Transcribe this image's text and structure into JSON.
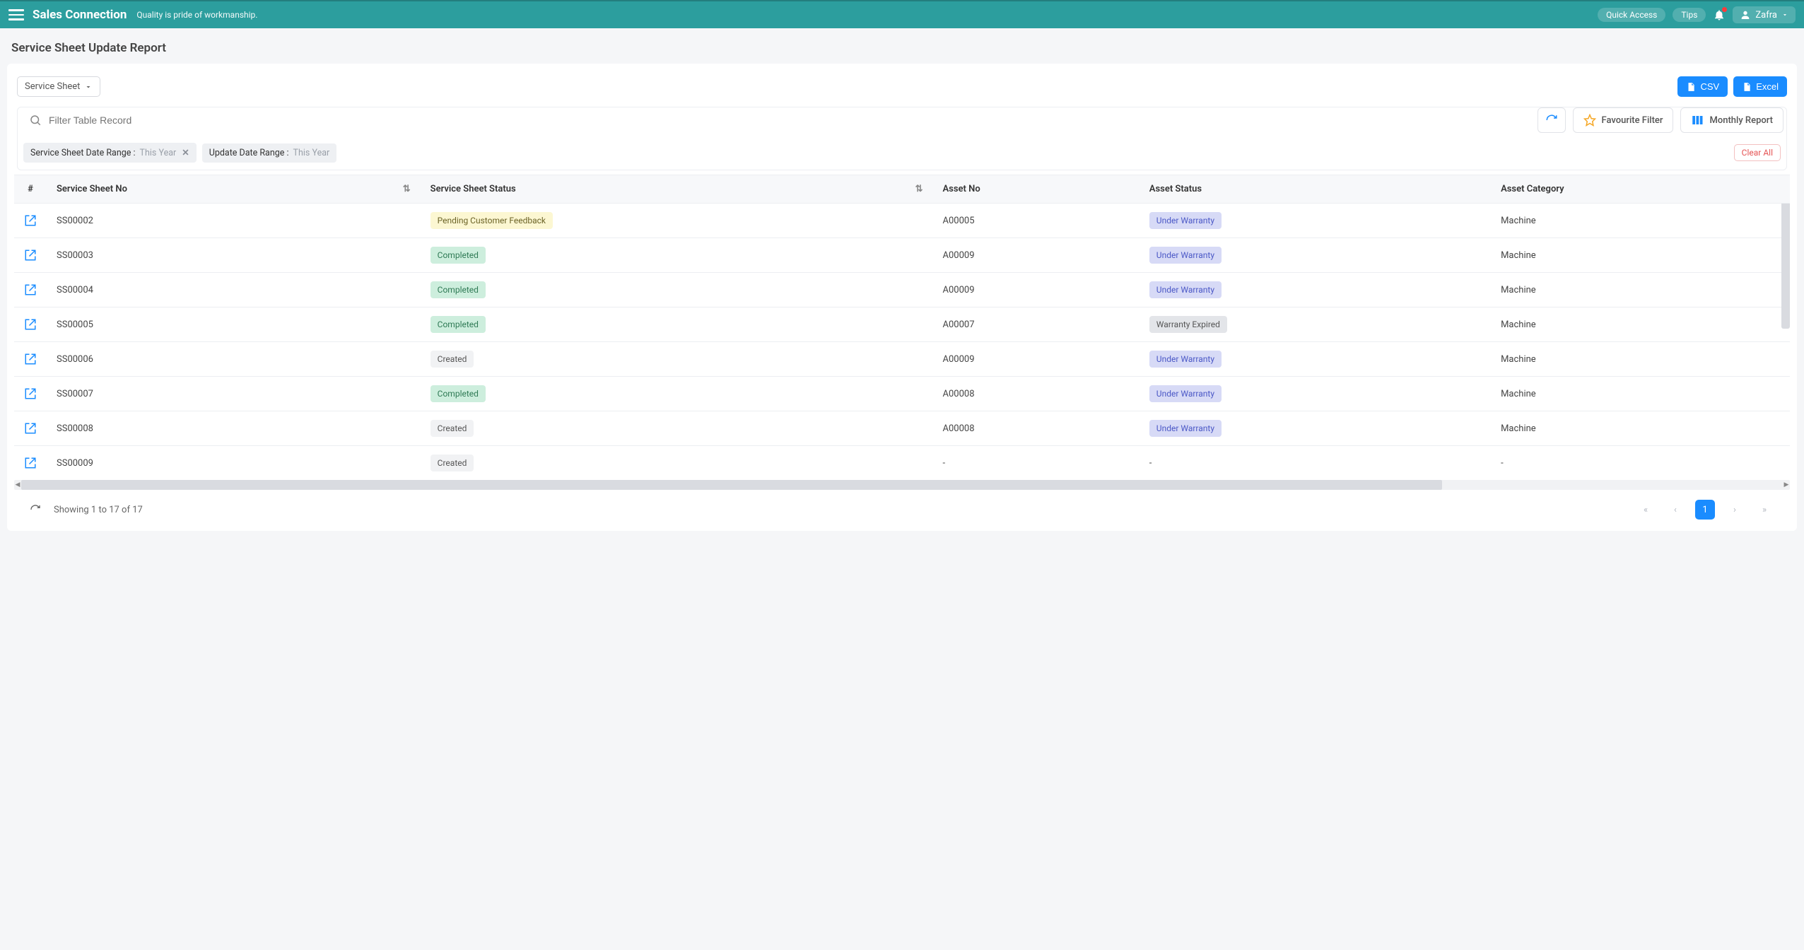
{
  "topbar": {
    "brand": "Sales Connection",
    "tagline": "Quality is pride of workmanship.",
    "quick_access": "Quick Access",
    "tips": "Tips",
    "user": "Zafra"
  },
  "page_title": "Service Sheet Update Report",
  "panel": {
    "type_dropdown": "Service Sheet",
    "csv_btn": "CSV",
    "excel_btn": "Excel",
    "search_placeholder": "Filter Table Record",
    "favourite_filter": "Favourite Filter",
    "monthly_report": "Monthly Report"
  },
  "filters": {
    "chip1_label": "Service Sheet Date Range :",
    "chip1_value": "This Year",
    "chip2_label": "Update Date Range :",
    "chip2_value": "This Year",
    "clear_all": "Clear All"
  },
  "columns": {
    "num": "#",
    "sheet_no": "Service Sheet No",
    "sheet_status": "Service Sheet Status",
    "asset_no": "Asset No",
    "asset_status": "Asset Status",
    "asset_category": "Asset Category"
  },
  "rows": [
    {
      "sheet_no": "SS00002",
      "sheet_status": "Pending Customer Feedback",
      "sheet_status_class": "badge-pending",
      "asset_no": "A00005",
      "asset_status": "Under Warranty",
      "asset_status_class": "badge-warranty",
      "asset_category": "Machine"
    },
    {
      "sheet_no": "SS00003",
      "sheet_status": "Completed",
      "sheet_status_class": "badge-completed",
      "asset_no": "A00009",
      "asset_status": "Under Warranty",
      "asset_status_class": "badge-warranty",
      "asset_category": "Machine"
    },
    {
      "sheet_no": "SS00004",
      "sheet_status": "Completed",
      "sheet_status_class": "badge-completed",
      "asset_no": "A00009",
      "asset_status": "Under Warranty",
      "asset_status_class": "badge-warranty",
      "asset_category": "Machine"
    },
    {
      "sheet_no": "SS00005",
      "sheet_status": "Completed",
      "sheet_status_class": "badge-completed",
      "asset_no": "A00007",
      "asset_status": "Warranty Expired",
      "asset_status_class": "badge-expired",
      "asset_category": "Machine"
    },
    {
      "sheet_no": "SS00006",
      "sheet_status": "Created",
      "sheet_status_class": "badge-created",
      "asset_no": "A00009",
      "asset_status": "Under Warranty",
      "asset_status_class": "badge-warranty",
      "asset_category": "Machine"
    },
    {
      "sheet_no": "SS00007",
      "sheet_status": "Completed",
      "sheet_status_class": "badge-completed",
      "asset_no": "A00008",
      "asset_status": "Under Warranty",
      "asset_status_class": "badge-warranty",
      "asset_category": "Machine"
    },
    {
      "sheet_no": "SS00008",
      "sheet_status": "Created",
      "sheet_status_class": "badge-created",
      "asset_no": "A00008",
      "asset_status": "Under Warranty",
      "asset_status_class": "badge-warranty",
      "asset_category": "Machine"
    },
    {
      "sheet_no": "SS00009",
      "sheet_status": "Created",
      "sheet_status_class": "badge-created",
      "asset_no": "-",
      "asset_status": "-",
      "asset_status_class": "",
      "asset_category": "-"
    }
  ],
  "footer": {
    "showing": "Showing 1 to 17 of 17",
    "page": "1"
  }
}
